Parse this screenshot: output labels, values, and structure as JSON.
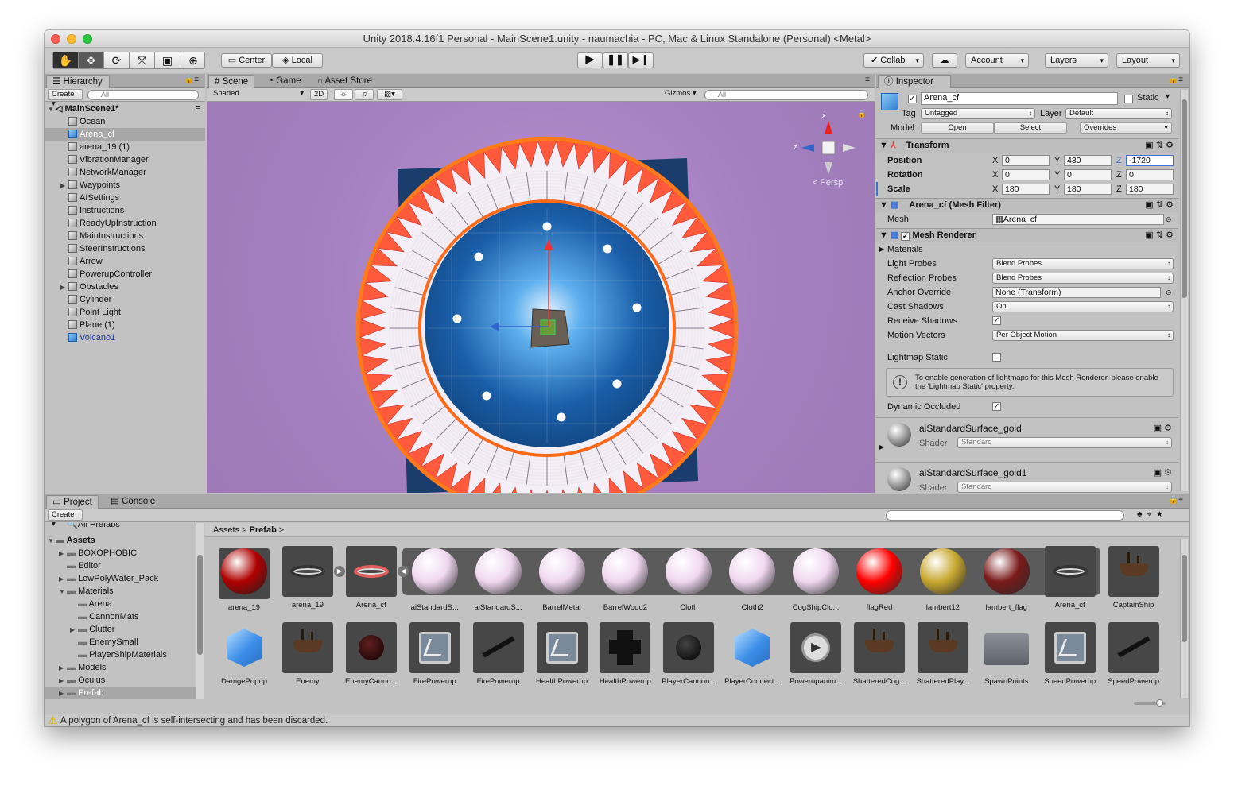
{
  "window": {
    "title": "Unity 2018.4.16f1 Personal - MainScene1.unity - naumachia - PC, Mac & Linux Standalone (Personal) <Metal>"
  },
  "toolbar": {
    "center": "Center",
    "local": "Local",
    "collab": "Collab",
    "account": "Account",
    "layers": "Layers",
    "layout": "Layout"
  },
  "hierarchy": {
    "tab": "Hierarchy",
    "create": "Create",
    "search_placeholder": "All",
    "scene": "MainScene1*",
    "items": [
      {
        "label": "Ocean",
        "icon": "grey",
        "expand": false
      },
      {
        "label": "Arena_cf",
        "icon": "blue",
        "expand": false,
        "selected": true
      },
      {
        "label": "arena_19 (1)",
        "icon": "grey",
        "expand": false
      },
      {
        "label": "VibrationManager",
        "icon": "grey",
        "expand": false
      },
      {
        "label": "NetworkManager",
        "icon": "grey",
        "expand": false
      },
      {
        "label": "Waypoints",
        "icon": "grey",
        "expand": true
      },
      {
        "label": "AISettings",
        "icon": "grey",
        "expand": false
      },
      {
        "label": "Instructions",
        "icon": "grey",
        "expand": false
      },
      {
        "label": "ReadyUpInstruction",
        "icon": "grey",
        "expand": false
      },
      {
        "label": "MainInstructions",
        "icon": "grey",
        "expand": false
      },
      {
        "label": "SteerInstructions",
        "icon": "grey",
        "expand": false
      },
      {
        "label": "Arrow",
        "icon": "grey",
        "expand": false
      },
      {
        "label": "PowerupController",
        "icon": "grey",
        "expand": false
      },
      {
        "label": "Obstacles",
        "icon": "grey",
        "expand": true
      },
      {
        "label": "Cylinder",
        "icon": "grey",
        "expand": false
      },
      {
        "label": "Point Light",
        "icon": "grey",
        "expand": false
      },
      {
        "label": "Plane (1)",
        "icon": "grey",
        "expand": false
      },
      {
        "label": "Volcano1",
        "icon": "blue",
        "expand": false,
        "prefab": true
      }
    ]
  },
  "scene": {
    "tabs": [
      "Scene",
      "Game",
      "Asset Store"
    ],
    "shading": "Shaded",
    "mode2d": "2D",
    "gizmos": "Gizmos",
    "search_placeholder": "All",
    "persp": "Persp",
    "axis_x": "x",
    "axis_z": "z"
  },
  "inspector": {
    "tab": "Inspector",
    "object_name": "Arena_cf",
    "static_label": "Static",
    "tag_label": "Tag",
    "tag_value": "Untagged",
    "layer_label": "Layer",
    "layer_value": "Default",
    "model_label": "Model",
    "open": "Open",
    "select": "Select",
    "overrides": "Overrides",
    "transform": {
      "title": "Transform",
      "position_label": "Position",
      "rotation_label": "Rotation",
      "scale_label": "Scale",
      "position": {
        "x": "0",
        "y": "430",
        "z": "-1720"
      },
      "rotation": {
        "x": "0",
        "y": "0",
        "z": "0"
      },
      "scale": {
        "x": "180",
        "y": "180",
        "z": "180"
      }
    },
    "mesh_filter": {
      "title": "Arena_cf (Mesh Filter)",
      "mesh_label": "Mesh",
      "mesh_value": "Arena_cf"
    },
    "mesh_renderer": {
      "title": "Mesh Renderer",
      "materials": "Materials",
      "rows": [
        {
          "label": "Light Probes",
          "value": "Blend Probes",
          "kind": "popup"
        },
        {
          "label": "Reflection Probes",
          "value": "Blend Probes",
          "kind": "popup"
        },
        {
          "label": "Anchor Override",
          "value": "None (Transform)",
          "kind": "field"
        },
        {
          "label": "Cast Shadows",
          "value": "On",
          "kind": "popup"
        },
        {
          "label": "Receive Shadows",
          "value": "✓",
          "kind": "check"
        },
        {
          "label": "Motion Vectors",
          "value": "Per Object Motion",
          "kind": "popup"
        }
      ],
      "lightmap_static": "Lightmap Static",
      "info": "To enable generation of lightmaps for this Mesh Renderer, please enable the 'Lightmap Static' property.",
      "dynamic_occluded": "Dynamic Occluded"
    },
    "materials": [
      {
        "name": "aiStandardSurface_gold",
        "shader_label": "Shader",
        "shader": "Standard"
      },
      {
        "name": "aiStandardSurface_gold1",
        "shader_label": "Shader",
        "shader": "Standard"
      }
    ]
  },
  "project": {
    "tabs": [
      "Project",
      "Console"
    ],
    "create": "Create",
    "fav": "All Prefabs",
    "assets_root": "Assets",
    "tree": [
      {
        "label": "BOXOPHOBIC",
        "indent": 1,
        "expand": true
      },
      {
        "label": "Editor",
        "indent": 1,
        "expand": false
      },
      {
        "label": "LowPolyWater_Pack",
        "indent": 1,
        "expand": true
      },
      {
        "label": "Materials",
        "indent": 1,
        "expand": true,
        "open": true
      },
      {
        "label": "Arena",
        "indent": 2,
        "expand": false
      },
      {
        "label": "CannonMats",
        "indent": 2,
        "expand": false
      },
      {
        "label": "Clutter",
        "indent": 2,
        "expand": true
      },
      {
        "label": "EnemySmall",
        "indent": 2,
        "expand": false
      },
      {
        "label": "PlayerShipMaterials",
        "indent": 2,
        "expand": false
      },
      {
        "label": "Models",
        "indent": 1,
        "expand": true
      },
      {
        "label": "Oculus",
        "indent": 1,
        "expand": true
      },
      {
        "label": "Prefab",
        "indent": 1,
        "expand": true,
        "selected": true
      }
    ],
    "breadcrumb": [
      "Assets",
      "Prefab"
    ],
    "row1": [
      {
        "label": "arena_19",
        "kind": "ball",
        "color": "#b00000"
      },
      {
        "label": "arena_19",
        "kind": "ring",
        "color": "#333333"
      },
      {
        "label": "Arena_cf",
        "kind": "ring",
        "color": "#e06060"
      },
      {
        "label": "aiStandardS...",
        "kind": "ball",
        "color": "#f0d8f0"
      },
      {
        "label": "aiStandardS...",
        "kind": "ball",
        "color": "#f0d8f0"
      },
      {
        "label": "BarrelMetal",
        "kind": "ball",
        "color": "#f0d8f0"
      },
      {
        "label": "BarrelWood2",
        "kind": "ball",
        "color": "#f0d8f0"
      },
      {
        "label": "Cloth",
        "kind": "ball",
        "color": "#f0d8f0"
      },
      {
        "label": "Cloth2",
        "kind": "ball",
        "color": "#f0d8f0"
      },
      {
        "label": "CogShipClo...",
        "kind": "ball",
        "color": "#f0d8f0"
      },
      {
        "label": "flagRed",
        "kind": "ball",
        "color": "#ff0000"
      },
      {
        "label": "lambert12",
        "kind": "ball",
        "color": "#c8a830"
      },
      {
        "label": "lambert_flag",
        "kind": "ball",
        "color": "#7a1a1a"
      },
      {
        "label": "Arena_cf",
        "kind": "ring",
        "color": "#333333"
      },
      {
        "label": "CaptainShip",
        "kind": "ship",
        "color": "#474747"
      }
    ],
    "row2": [
      {
        "label": "DamgePopup",
        "kind": "cube"
      },
      {
        "label": "Enemy",
        "kind": "ship"
      },
      {
        "label": "EnemyCanno...",
        "kind": "dot"
      },
      {
        "label": "FirePowerup",
        "kind": "flow"
      },
      {
        "label": "FirePowerup",
        "kind": "cannon"
      },
      {
        "label": "HealthPowerup",
        "kind": "flow"
      },
      {
        "label": "HealthPowerup",
        "kind": "cross"
      },
      {
        "label": "PlayerCannon...",
        "kind": "dot"
      },
      {
        "label": "PlayerConnect...",
        "kind": "cube"
      },
      {
        "label": "Powerupanim...",
        "kind": "play"
      },
      {
        "label": "ShatteredCog...",
        "kind": "ship"
      },
      {
        "label": "ShatteredPlay...",
        "kind": "ship"
      },
      {
        "label": "SpawnPoints",
        "kind": "folder"
      },
      {
        "label": "SpeedPowerup",
        "kind": "flow"
      },
      {
        "label": "SpeedPowerup",
        "kind": "cannon"
      }
    ]
  },
  "status": {
    "message": "A polygon of Arena_cf is self-intersecting and has been discarded."
  },
  "colors": {
    "accent": "#3a72d8",
    "scene_bg": "#a47fc0",
    "water": "#1a5ea8",
    "cone": "#ff5a3c",
    "selection": "#a7a7a7"
  }
}
